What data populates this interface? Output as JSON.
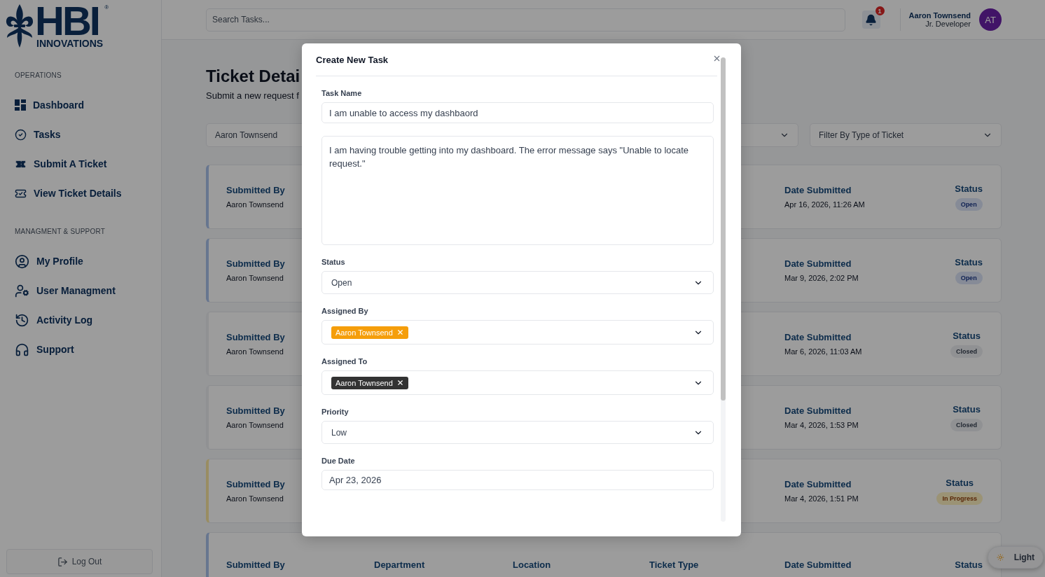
{
  "logo": {
    "name": "HBI",
    "tagline": "INNOVATIONS",
    "mark": "®"
  },
  "sidebar": {
    "sections": [
      {
        "title": "OPERATIONS",
        "items": [
          {
            "label": "Dashboard",
            "kind": "dashboard"
          },
          {
            "label": "Tasks",
            "kind": "tasks"
          },
          {
            "label": "Submit A Ticket",
            "kind": "submit"
          },
          {
            "label": "View Ticket Details",
            "kind": "view"
          }
        ]
      },
      {
        "title": "MANAGMENT & SUPPORT",
        "items": [
          {
            "label": "My Profile",
            "kind": "profile"
          },
          {
            "label": "User Managment",
            "kind": "users"
          },
          {
            "label": "Activity Log",
            "kind": "activity"
          },
          {
            "label": "Support",
            "kind": "support"
          }
        ]
      }
    ],
    "logout": "Log Out"
  },
  "topbar": {
    "search": {
      "placeholder": "Search Tasks..."
    },
    "notifications": {
      "count": "1"
    },
    "user": {
      "name": "Aaron Townsend",
      "role": "Jr. Developer",
      "initials": "AT"
    }
  },
  "page": {
    "title": "Ticket Detai",
    "subtitle": "Submit a new request f"
  },
  "filters": [
    {
      "kind": "text",
      "value": "Aaron Townsend"
    },
    {
      "kind": "dropdown"
    },
    {
      "kind": "dropdown",
      "placeholder": "Filter By Type of Ticket"
    }
  ],
  "tickets": [
    {
      "fields": [
        {
          "kind": "submitted_by",
          "label": "Submitted By",
          "value": "Aaron Townsend"
        },
        {
          "kind": "date",
          "label": "Date Submitted",
          "value": "Apr 16, 2026, 11:26 AM"
        }
      ],
      "status": {
        "label": "Status",
        "value": "Open",
        "kind": "open"
      }
    },
    {
      "fields": [
        {
          "kind": "submitted_by",
          "label": "Submitted By",
          "value": "Aaron Townsend"
        },
        {
          "kind": "date",
          "label": "Date Submitted",
          "value": "Mar 9, 2026, 2:02 PM"
        }
      ],
      "status": {
        "label": "Status",
        "value": "Open",
        "kind": "open"
      }
    },
    {
      "fields": [
        {
          "kind": "submitted_by",
          "label": "Submitted By",
          "value": "Aaron Townsend"
        },
        {
          "kind": "date",
          "label": "Date Submitted",
          "value": "Mar 6, 2026, 11:03 AM"
        }
      ],
      "status": {
        "label": "Status",
        "value": "Closed",
        "kind": "closed"
      }
    },
    {
      "fields": [
        {
          "kind": "submitted_by",
          "label": "Submitted By",
          "value": "Aaron Townsend"
        },
        {
          "kind": "date",
          "label": "Date Submitted",
          "value": "Mar 4, 2026, 1:53 PM"
        }
      ],
      "status": {
        "label": "Status",
        "value": "Closed",
        "kind": "closed"
      }
    },
    {
      "fields": [
        {
          "kind": "submitted_by",
          "label": "Submitted By",
          "value": "Aaron Townsend"
        },
        {
          "kind": "date",
          "label": "Date Submitted",
          "value": "Mar 4, 2026, 1:51 PM"
        }
      ],
      "status": {
        "label": "Status",
        "value": "In Progress",
        "kind": "in_progress"
      }
    },
    {
      "fields": [
        {
          "kind": "submitted_by",
          "label": "Submitted By"
        },
        {
          "kind": "department",
          "label": "Department"
        },
        {
          "kind": "location",
          "label": "Location"
        },
        {
          "kind": "ticket_type",
          "label": "Ticket Type"
        },
        {
          "kind": "date",
          "label": "Date Submitted"
        }
      ],
      "status": {
        "label": "Status",
        "kind": "open"
      }
    }
  ],
  "theme_toggle": {
    "label": "Light"
  },
  "modal": {
    "title": "Create New Task",
    "fields": [
      {
        "kind": "text",
        "label": "Task Name",
        "value": "I am unable to access my dashbaord"
      },
      {
        "kind": "textarea",
        "value": "I am having trouble getting into my dashboard. The error message says \"Unable to locate request.\""
      },
      {
        "kind": "select",
        "label": "Status",
        "value": "Open"
      },
      {
        "kind": "multiselect",
        "label": "Assigned By",
        "chips": [
          {
            "label": "Aaron Townsend",
            "color": "#f59e0b"
          }
        ]
      },
      {
        "kind": "multiselect",
        "label": "Assigned To",
        "chips": [
          {
            "label": "Aaron Townsend",
            "color": "#333333"
          }
        ]
      },
      {
        "kind": "select",
        "label": "Priority",
        "value": "Low"
      },
      {
        "kind": "text",
        "label": "Due Date",
        "value": "Apr 23, 2026"
      }
    ]
  }
}
